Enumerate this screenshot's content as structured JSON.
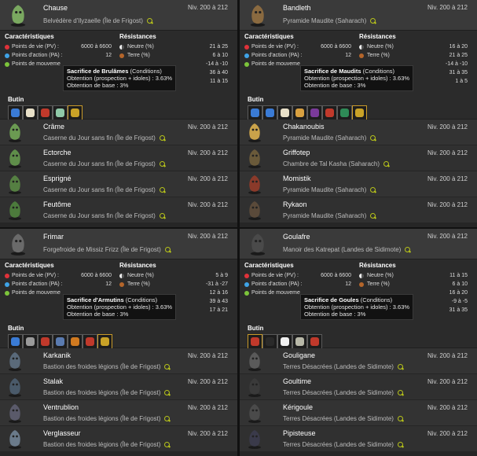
{
  "labels": {
    "caracteristiques": "Caractéristiques",
    "resistances": "Résistances",
    "butin": "Butin",
    "pv": "Points de vie (PV) :",
    "pa": "Points d'action (PA) :",
    "pm": "Points de mouveme",
    "neutre": "Neutre (%)",
    "terre": "Terre (%)"
  },
  "quadrants": [
    {
      "expanded": {
        "name": "Chause",
        "level": "Niv. 200 à 212",
        "location": "Belvédère d'Ilyzaelle (Île de Frigost)",
        "pv": "6000 à 6600",
        "pa": "12",
        "resistances": [
          "21 à 25",
          "6 à 10",
          "-14 à -10",
          "36 à 40",
          "11 à 15"
        ],
        "tooltip": {
          "name": "Sacrifice de Brulâmes",
          "cond": " (Conditions)",
          "line2": "Obtention (prospection + idoles) : 3.63%",
          "line3": "Obtention de base : 3%"
        },
        "loot_count": 5
      },
      "rows": [
        {
          "name": "Crâme",
          "level": "Niv. 200 à 212",
          "location": "Caserne du Jour sans fin (Île de Frigost)"
        },
        {
          "name": "Ectorche",
          "level": "Niv. 200 à 212",
          "location": "Caserne du Jour sans fin (Île de Frigost)"
        },
        {
          "name": "Esprigné",
          "level": "Niv. 200 à 212",
          "location": "Caserne du Jour sans fin (Île de Frigost)"
        },
        {
          "name": "Feutôme",
          "level": "Niv. 200 à 212",
          "location": "Caserne du Jour sans fin (Île de Frigost)"
        }
      ]
    },
    {
      "expanded": {
        "name": "Bandleth",
        "level": "Niv. 200 à 212",
        "location": "Pyramide Maudite (Saharach)",
        "pv": "6000 à 6600",
        "pa": "12",
        "resistances": [
          "16 à 20",
          "21 à 25",
          "-14 à -10",
          "31 à 35",
          "1 à 5"
        ],
        "tooltip": {
          "name": "Sacrifice de Maudits",
          "cond": " (Conditions)",
          "line2": "Obtention (prospection + idoles) : 3.63%",
          "line3": "Obtention de base : 3%"
        },
        "loot_count": 8
      },
      "rows": [
        {
          "name": "Chakanoubis",
          "level": "Niv. 200 à 212",
          "location": "Pyramide Maudite (Saharach)"
        },
        {
          "name": "Griffotep",
          "level": "Niv. 200 à 212",
          "location": "Chambre de Tal Kasha (Saharach)"
        },
        {
          "name": "Momistik",
          "level": "Niv. 200 à 212",
          "location": "Pyramide Maudite (Saharach)"
        },
        {
          "name": "Rykaon",
          "level": "Niv. 200 à 212",
          "location": "Pyramide Maudite (Saharach)"
        }
      ]
    },
    {
      "expanded": {
        "name": "Frimar",
        "level": "Niv. 200 à 212",
        "location": "Forgefroide de Missiz Frizz (Île de Frigost)",
        "pv": "6000 à 6600",
        "pa": "12",
        "resistances": [
          "5 à 9",
          "-31 à -27",
          "12 à 16",
          "39 à 43",
          "17 à 21"
        ],
        "tooltip": {
          "name": "Sacrifice d'Armutins",
          "cond": " (Conditions)",
          "line2": "Obtention (prospection + idoles) : 3.63%",
          "line3": "Obtention de base : 3%"
        },
        "loot_count": 7
      },
      "rows": [
        {
          "name": "Karkanik",
          "level": "Niv. 200 à 212",
          "location": "Bastion des froides légions (Île de Frigost)"
        },
        {
          "name": "Stalak",
          "level": "Niv. 200 à 212",
          "location": "Bastion des froides légions (Île de Frigost)"
        },
        {
          "name": "Ventrublion",
          "level": "Niv. 200 à 212",
          "location": "Bastion des froides légions (Île de Frigost)"
        },
        {
          "name": "Verglasseur",
          "level": "Niv. 200 à 212",
          "location": "Bastion des froides légions (Île de Frigost)"
        }
      ]
    },
    {
      "expanded": {
        "name": "Goulafre",
        "level": "Niv. 200 à 212",
        "location": "Manoir des Katrepat (Landes de Sidimote)",
        "pv": "6000 à 6600",
        "pa": "12",
        "resistances": [
          "11 à 15",
          "6 à 10",
          "16 à 20",
          "-9 à -5",
          "31 à 35"
        ],
        "tooltip": {
          "name": "Sacrifice de Goules",
          "cond": " (Conditions)",
          "line2": "Obtention (prospection + idoles) : 3.63%",
          "line3": "Obtention de base : 3%"
        },
        "loot_count": 5
      },
      "rows": [
        {
          "name": "Gouligane",
          "level": "Niv. 200 à 212",
          "location": "Terres Désacrées (Landes de Sidimote)"
        },
        {
          "name": "Goultime",
          "level": "Niv. 200 à 212",
          "location": "Terres Désacrées (Landes de Sidimote)"
        },
        {
          "name": "Kérigoule",
          "level": "Niv. 200 à 212",
          "location": "Terres Désacrées (Landes de Sidimote)"
        },
        {
          "name": "Pipisteuse",
          "level": "Niv. 200 à 212",
          "location": "Terres Désacrées (Landes de Sidimote)"
        }
      ]
    }
  ],
  "colors": {
    "pv": "#e0323a",
    "pa": "#3fa3e6",
    "pm": "#7cc43b",
    "pin": "#b8c41a",
    "rare_border": "#c89a2a"
  },
  "icons": {
    "location": "map-pin-icon",
    "neutre": "neutral-element-icon",
    "terre": "earth-element-icon",
    "pv": "heart-icon",
    "pa": "star-icon",
    "pm": "boot-icon"
  }
}
